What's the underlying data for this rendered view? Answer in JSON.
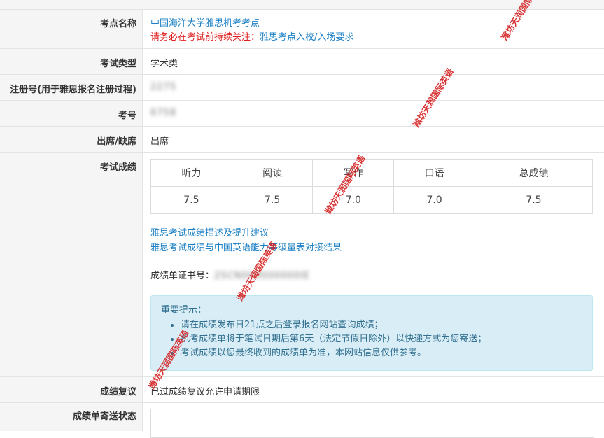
{
  "site_name": {
    "label": "考点名称",
    "value": "中国海洋大学雅思机考考点",
    "warning_prefix": "请务必在考试前持续关注：",
    "warning_link": "雅思考点入校/入场要求"
  },
  "exam_type": {
    "label": "考试类型",
    "value": "学术类"
  },
  "reg_no": {
    "label": "注册号(用于雅思报名注册过程)",
    "value": "2275"
  },
  "exam_no": {
    "label": "考号",
    "value": "6758"
  },
  "attendance": {
    "label": "出席/缺席",
    "value": "出席"
  },
  "scores": {
    "label": "考试成绩",
    "headers": [
      "听力",
      "阅读",
      "写作",
      "口语",
      "总成绩"
    ],
    "values": [
      "7.5",
      "7.5",
      "7.0",
      "7.0",
      "7.5"
    ],
    "link1": "雅思考试成绩描述及提升建议",
    "link2": "雅思考试成绩与中国英语能力等级量表对接结果",
    "report_label": "成绩单证书号：",
    "report_value": "25CN000000000IE",
    "notice_title": "重要提示：",
    "notice_items": [
      "请在成绩发布日21点之后登录报名网站查询成绩；",
      "机考成绩单将于笔试日期后第6天（法定节假日除外）以快递方式为您寄送；",
      "考试成绩以您最终收到的成绩单为准，本网站信息仅供参考。"
    ]
  },
  "recheck": {
    "label": "成绩复议",
    "value": "已过成绩复议允许申请期限"
  },
  "mail_status": {
    "label": "成绩单寄送状态"
  },
  "watermark": "潍坊天润国际英语"
}
